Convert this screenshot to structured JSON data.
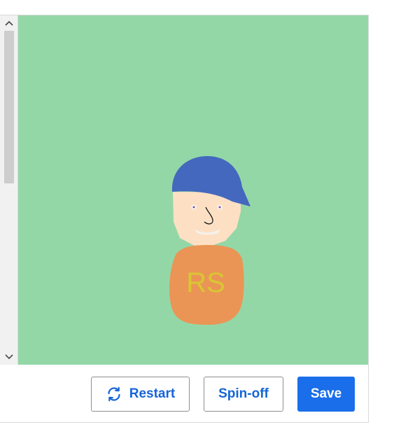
{
  "scrollbar": {
    "up_icon": "chevron-up-icon",
    "down_icon": "chevron-down-icon"
  },
  "canvas": {
    "background": "#94d7a7",
    "character": {
      "cap_color": "#4468be",
      "skin_color": "#fde0c4",
      "shirt_color": "#ea9556",
      "shirt_text_color": "#d9c632",
      "shirt_text": "RS"
    }
  },
  "toolbar": {
    "restart_label": "Restart",
    "restart_icon": "refresh-icon",
    "spinoff_label": "Spin-off",
    "save_label": "Save"
  },
  "colors": {
    "primary": "#1a6eea",
    "link_text": "#1565d8"
  }
}
